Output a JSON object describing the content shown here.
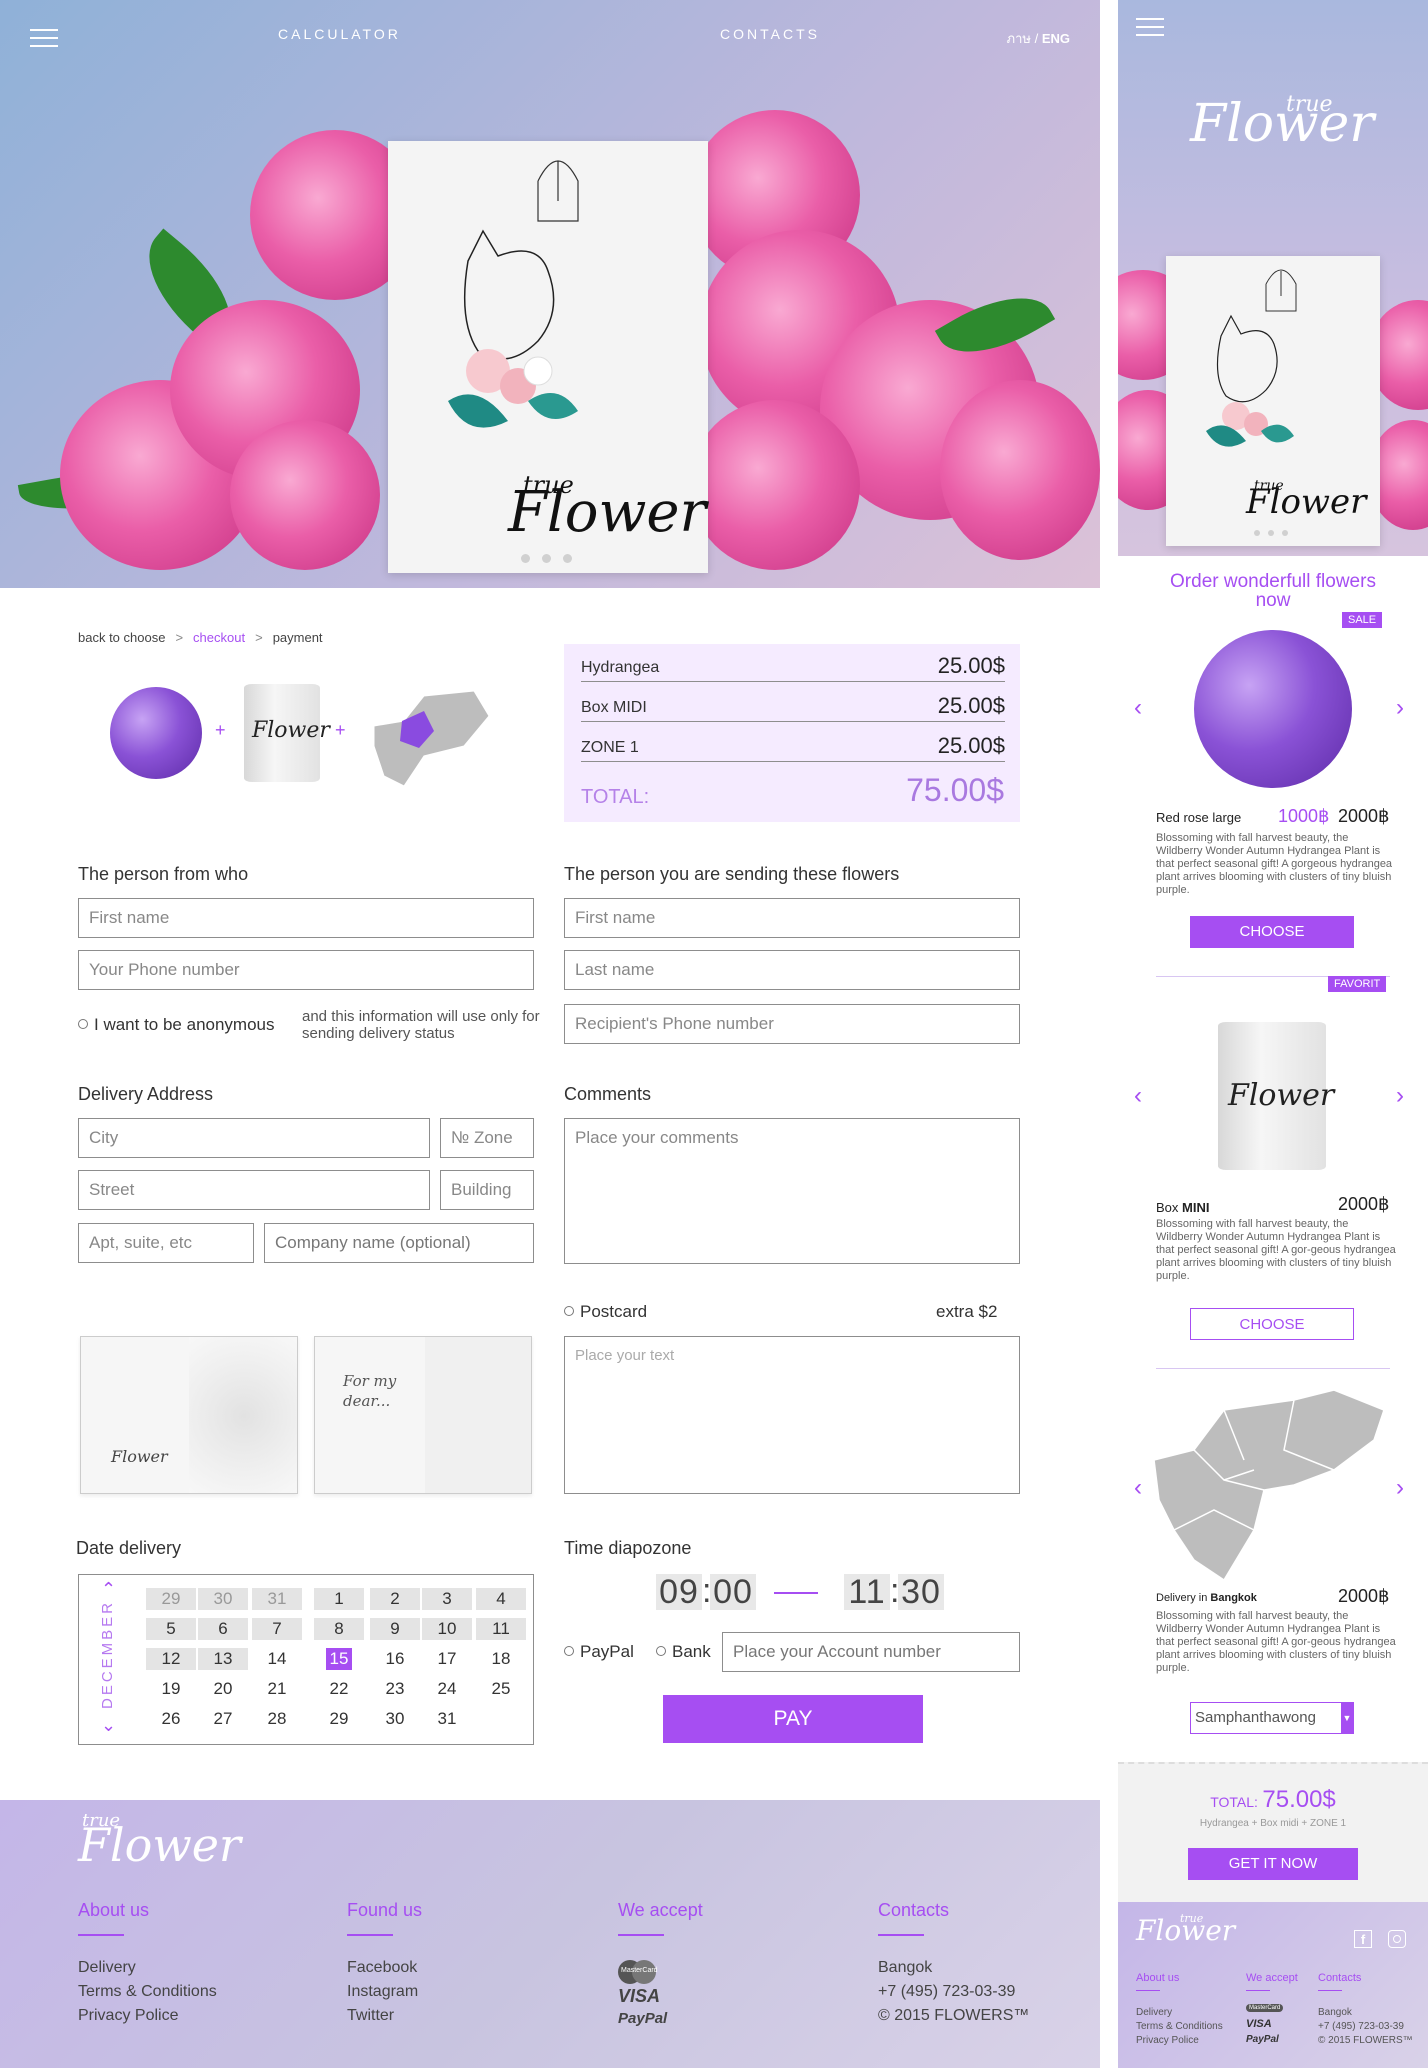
{
  "nav": {
    "calculator": "CALCULATOR",
    "contacts": "CONTACTS",
    "lang_th": "ภาษ /",
    "lang_eng": "ENG"
  },
  "brand": {
    "line1": "true",
    "line2": "Flower"
  },
  "breadcrumb": {
    "back": "back to choose",
    "sep1": ">",
    "checkout": "checkout",
    "sep2": ">",
    "payment": "payment"
  },
  "summary": {
    "rows": [
      {
        "label": "Hydrangea",
        "value": "25.00$"
      },
      {
        "label": "Box MIDI",
        "value": "25.00$"
      },
      {
        "label": "ZONE 1",
        "value": "25.00$"
      }
    ],
    "total_label": "TOTAL:",
    "total_value": "75.00$"
  },
  "plus": "+",
  "sender": {
    "heading": "The person from who",
    "first_name_ph": "First name",
    "phone_ph": "Your Phone number",
    "anon_label": "I want to be anonymous",
    "anon_note": "and this information will use only for sending delivery status"
  },
  "recipient": {
    "heading": "The person you are sending these flowers",
    "first_name_ph": "First name",
    "last_name_ph": "Last name",
    "phone_ph": "Recipient's Phone number"
  },
  "delivery": {
    "heading": "Delivery Address",
    "city_ph": "City",
    "zone_ph": "№ Zone",
    "street_ph": "Street",
    "building_ph": "Building",
    "apt_ph": "Apt, suite, etc",
    "company_ph": "Company name (optional)"
  },
  "comments": {
    "heading": "Comments",
    "ph": "Place your comments"
  },
  "postcard": {
    "label": "Postcard",
    "extra": "extra $2",
    "text_ph": "Place your text",
    "card2_text": "For my dear..."
  },
  "date": {
    "heading": "Date delivery",
    "month": "DECEMBER",
    "weeks": [
      [
        "29",
        "30",
        "31",
        "1",
        "2",
        "3",
        "4"
      ],
      [
        "5",
        "6",
        "7",
        "8",
        "9",
        "10",
        "11"
      ],
      [
        "12",
        "13",
        "14",
        "15",
        "16",
        "17",
        "18"
      ],
      [
        "19",
        "20",
        "21",
        "22",
        "23",
        "24",
        "25"
      ],
      [
        "26",
        "27",
        "28",
        "29",
        "30",
        "31",
        ""
      ]
    ],
    "selected": "15"
  },
  "time": {
    "heading": "Time diapozone",
    "from_h": "09",
    "from_m": "00",
    "to_h": "11",
    "to_m": "30",
    "colon": ":"
  },
  "payment": {
    "paypal": "PayPal",
    "bank": "Bank",
    "account_ph": "Place your Account number",
    "pay_button": "PAY"
  },
  "footer": {
    "about": {
      "heading": "About us",
      "links": [
        "Delivery",
        "Terms & Conditions",
        "Privacy Police"
      ]
    },
    "found": {
      "heading": "Found us",
      "links": [
        "Facebook",
        "Instagram",
        "Twitter"
      ]
    },
    "accept": {
      "heading": "We accept",
      "logos": [
        "MasterCard",
        "VISA",
        "PayPal"
      ]
    },
    "contacts": {
      "heading": "Contacts",
      "lines": [
        "Bangok",
        "+7 (495) 723-03-39",
        "© 2015 FLOWERS™"
      ]
    }
  },
  "mobile": {
    "headline": "Order wonderfull flowers now",
    "products": [
      {
        "badge": "SALE",
        "name": "Red rose large",
        "price_new": "1000฿",
        "price_old": "2000฿",
        "desc": "Blossoming with fall harvest beauty, the Wildberry Wonder Autumn Hydrangea Plant is that perfect seasonal gift! A gorgeous hydrangea plant arrives blooming with clusters of tiny bluish purple.",
        "button": "CHOOSE"
      },
      {
        "badge": "FAVORIT",
        "name_prefix": "Box",
        "name_bold": "MINI",
        "price": "2000฿",
        "desc": "Blossoming with fall harvest beauty, the Wildberry Wonder Autumn Hydrangea Plant is that perfect seasonal gift! A gor-geous hydrangea plant arrives blooming with clusters of tiny bluish purple.",
        "button": "CHOOSE"
      },
      {
        "name_prefix": "Delivery in",
        "name_bold": "Bangkok",
        "price": "2000฿",
        "desc": "Blossoming with fall harvest beauty, the Wildberry Wonder Autumn Hydrangea Plant is that perfect seasonal gift! A gor-geous hydrangea plant arrives blooming with clusters of tiny bluish purple.",
        "select": "Samphanthawong"
      }
    ],
    "total_label": "TOTAL:",
    "total_value": "75.00$",
    "total_sub": "Hydrangea + Box midi + ZONE 1",
    "cta": "GET IT NOW",
    "footer": {
      "about": "About us",
      "accept": "We accept",
      "contacts": "Contacts",
      "links": [
        "Delivery",
        "Terms & Conditions",
        "Privacy Police"
      ],
      "logos": [
        "MasterCard",
        "VISA",
        "PayPal"
      ],
      "contact_lines": [
        "Bangok",
        "+7 (495) 723-03-39",
        "© 2015 FLOWERS™"
      ]
    }
  },
  "colors": {
    "accent": "#a64ef2",
    "summary_bg": "#f5ebff",
    "calendar_grey": "#e4e4e4"
  }
}
